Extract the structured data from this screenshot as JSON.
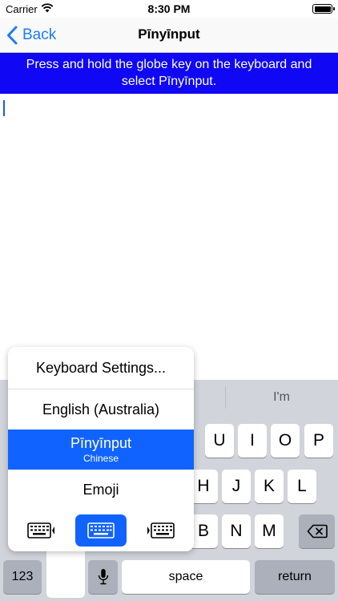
{
  "status_bar": {
    "carrier": "Carrier",
    "time": "8:30 PM"
  },
  "nav": {
    "back_label": "Back",
    "title": "Pīnyīnput"
  },
  "banner": {
    "text": "Press and hold the globe key on the keyboard and select Pīnyīnput."
  },
  "keyboard": {
    "predictions": [
      "",
      "",
      "I'm"
    ],
    "row1_visible": [
      "U",
      "I",
      "O",
      "P"
    ],
    "row2_visible": [
      "H",
      "J",
      "K",
      "L"
    ],
    "row3_visible": [
      "B",
      "N",
      "M"
    ],
    "number_key": "123",
    "space_key": "space",
    "return_key": "return"
  },
  "input_menu": {
    "items": [
      {
        "label": "Keyboard Settings..."
      },
      {
        "label": "English (Australia)"
      },
      {
        "label": "Pīnyīnput",
        "sublabel": "Chinese",
        "selected": true
      },
      {
        "label": "Emoji"
      }
    ],
    "accent_color": "#1163ff"
  },
  "colors": {
    "banner_bg": "#1007f5",
    "link": "#1a7cff"
  }
}
